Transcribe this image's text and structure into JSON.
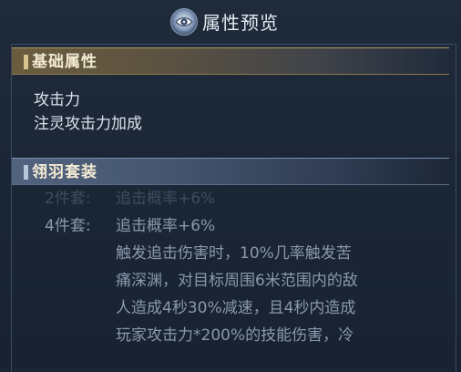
{
  "header": {
    "title": "属性预览",
    "icon": "eye-icon"
  },
  "sections": {
    "base": {
      "title": "基础属性",
      "stats": [
        "攻击力",
        "注灵攻击力加成"
      ]
    },
    "set": {
      "title": "翎羽套装",
      "two_piece_label": "2件套:",
      "two_piece_value": "追击概率+6%",
      "four_piece_label": "4件套:",
      "four_piece_value": "追击概率+6%",
      "four_piece_desc": [
        "触发追击伤害时，10%几率触发苦",
        "痛深渊，对目标周围6米范围内的敌",
        "人造成4秒30%减速，且4秒内造成",
        "玩家攻击力*200%的技能伤害，冷"
      ]
    }
  },
  "colors": {
    "base_bar": "#6a5d3f",
    "set_bar": "#51637f",
    "text_primary": "#dbe1ea",
    "text_dim": "#8a99ac"
  }
}
